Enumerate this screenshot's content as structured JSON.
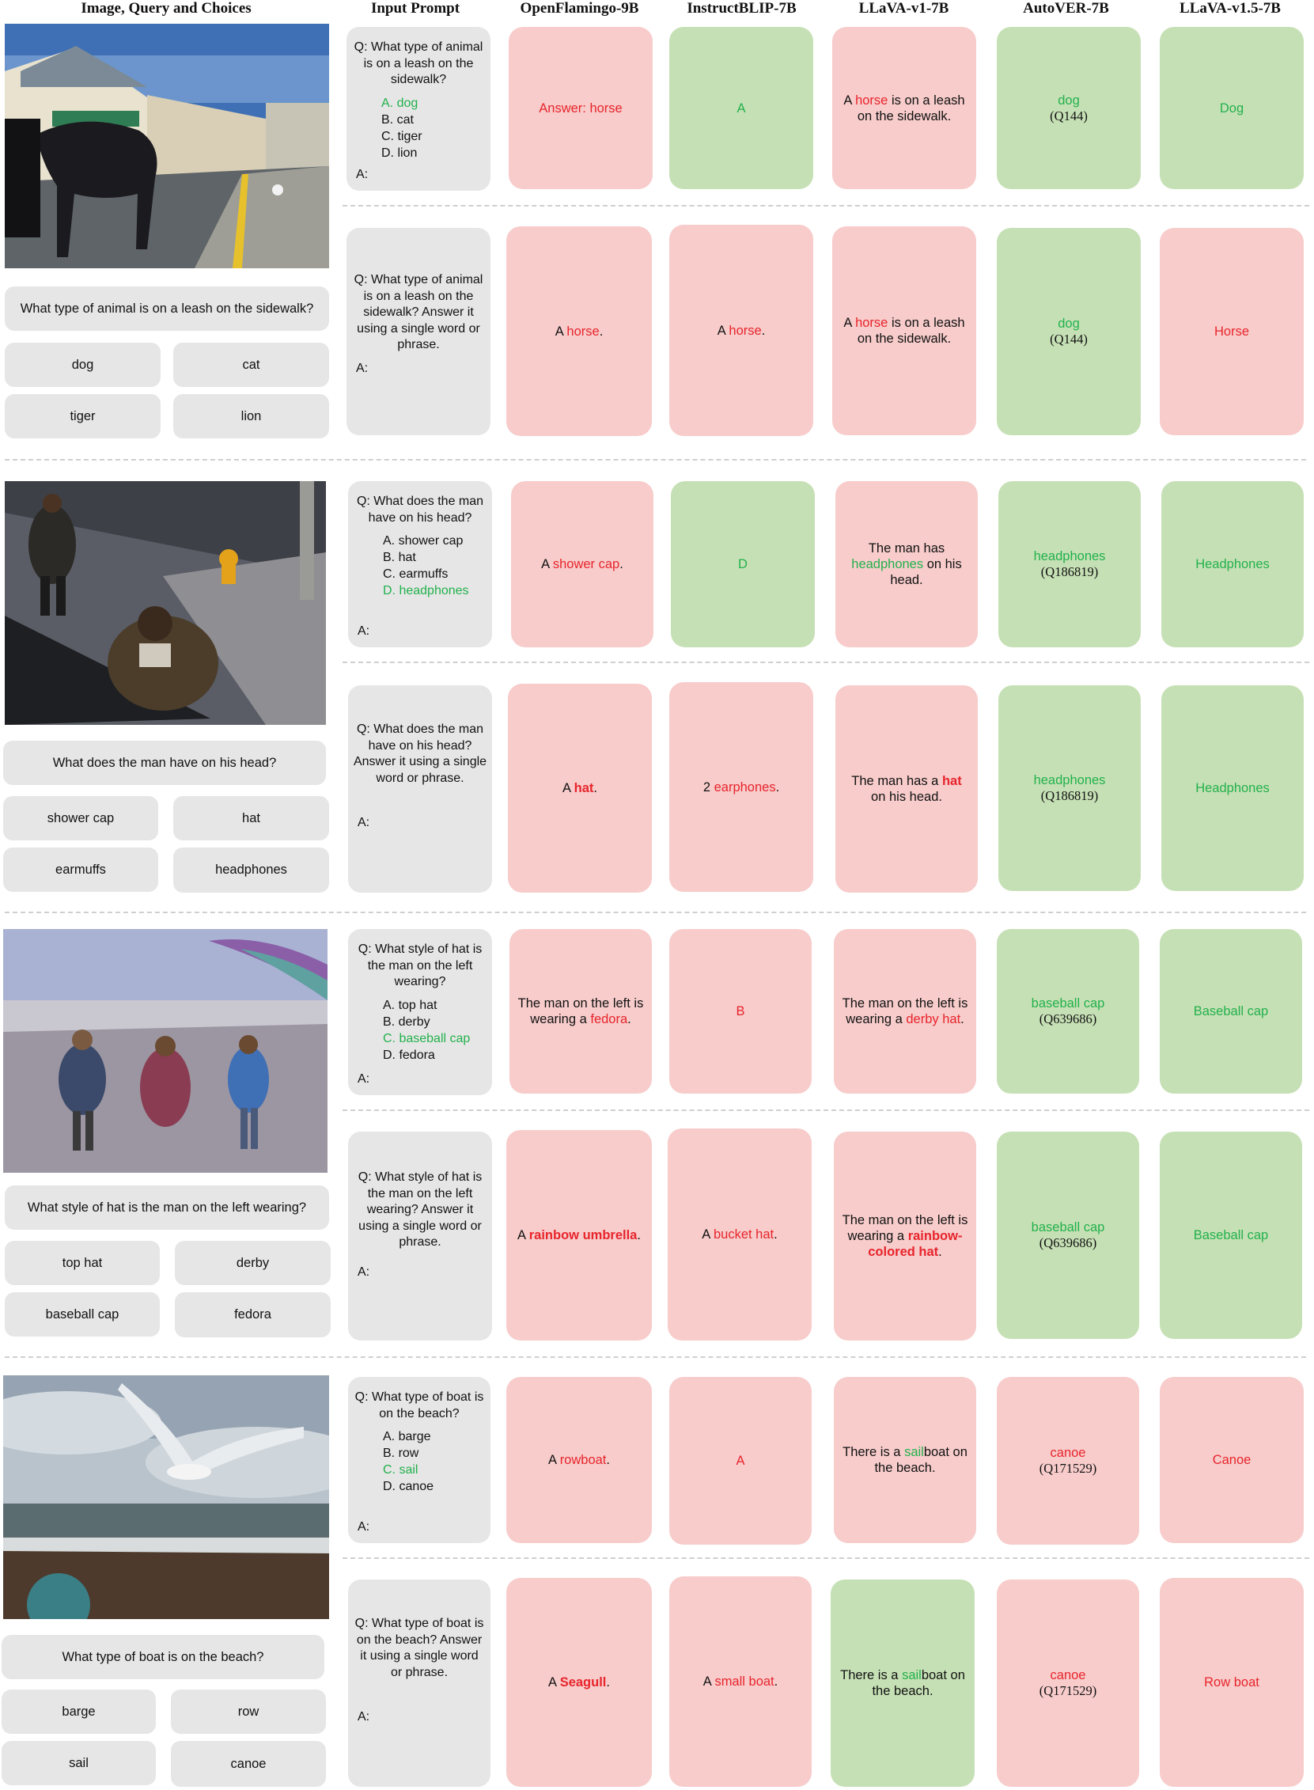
{
  "headers": [
    "Image, Query and Choices",
    "Input Prompt",
    "OpenFlamingo-9B",
    "InstructBLIP-7B",
    "LLaVA-v1-7B",
    "AutoVER-7B",
    "LLaVA-v1.5-7B"
  ],
  "examples": [
    {
      "query": "What type of animal is on a leash on the sidewalk?",
      "choices": [
        "dog",
        "cat",
        "tiger",
        "lion"
      ],
      "mc_prompt": {
        "question": "Q: What type of animal is on a leash on the sidewalk?",
        "options": [
          "A.  dog",
          "B.  cat",
          "C.  tiger",
          "D.  lion"
        ],
        "correct": 0,
        "answer_label": "A:"
      },
      "oe_prompt": {
        "question": "Q: What type of animal is on a leash on the sidewalk? Answer it using a single word or phrase.",
        "answer_label": "A:"
      },
      "mc_answers": {
        "openflamingo": {
          "pre": "",
          "hl": "Answer: horse",
          "post": ""
        },
        "instructblip": {
          "pre": "",
          "hl": "A",
          "post": ""
        },
        "llava_v1": {
          "pre": "A ",
          "hl": "horse",
          "post": " is on a leash on the sidewalk."
        },
        "autover": {
          "entity": "dog",
          "qid": "(Q144)"
        },
        "llava_v15": {
          "pre": "",
          "hl": "Dog",
          "post": ""
        }
      },
      "oe_answers": {
        "openflamingo": {
          "pre": "A ",
          "hl": "horse",
          "post": "."
        },
        "instructblip": {
          "pre": "A ",
          "hl": "horse",
          "post": "."
        },
        "llava_v1": {
          "pre": "A ",
          "hl": "horse",
          "post": " is on a leash on the sidewalk."
        },
        "autover": {
          "entity": "dog",
          "qid": "(Q144)"
        },
        "llava_v15": {
          "pre": "",
          "hl": "Horse",
          "post": ""
        }
      }
    },
    {
      "query": "What does the man have on his head?",
      "choices": [
        "shower cap",
        "hat",
        "earmuffs",
        "headphones"
      ],
      "mc_prompt": {
        "question": "Q: What does the man have on his head?",
        "options": [
          "A.  shower cap",
          "B.  hat",
          "C.  earmuffs",
          "D.  headphones"
        ],
        "correct": 3,
        "answer_label": "A:"
      },
      "oe_prompt": {
        "question": "Q: What does the man have on his head? Answer it using a single word or phrase.",
        "answer_label": "A:"
      },
      "mc_answers": {
        "openflamingo": {
          "pre": "A ",
          "hl": "shower cap",
          "post": "."
        },
        "instructblip": {
          "pre": "",
          "hl": "D",
          "post": ""
        },
        "llava_v1": {
          "pre": "The man has ",
          "hl": "headphones",
          "post": " on his head."
        },
        "autover": {
          "entity": "headphones",
          "qid": "(Q186819)"
        },
        "llava_v15": {
          "pre": "",
          "hl": "Headphones",
          "post": ""
        }
      },
      "oe_answers": {
        "openflamingo": {
          "pre": "A ",
          "hl": "hat",
          "post": "."
        },
        "instructblip": {
          "pre": "2 ",
          "hl": "earphones",
          "post": "."
        },
        "llava_v1": {
          "pre": "The man has a ",
          "hl": "hat",
          "post": " on his head."
        },
        "autover": {
          "entity": "headphones",
          "qid": "(Q186819)"
        },
        "llava_v15": {
          "pre": "",
          "hl": "Headphones",
          "post": ""
        }
      }
    },
    {
      "query": "What style of hat is the man on the left wearing?",
      "choices": [
        "top hat",
        "derby",
        "baseball cap",
        "fedora"
      ],
      "mc_prompt": {
        "question": "Q: What style of hat is the man on the left wearing?",
        "options": [
          "A.  top hat",
          "B.  derby",
          "C.  baseball cap",
          "D.  fedora"
        ],
        "correct": 2,
        "answer_label": "A:"
      },
      "oe_prompt": {
        "question": "Q: What style of hat is the man on the left wearing? Answer it using a single word or phrase.",
        "answer_label": "A:"
      },
      "mc_answers": {
        "openflamingo": {
          "pre": "The man on the left is wearing a ",
          "hl": "fedora",
          "post": "."
        },
        "instructblip": {
          "pre": "",
          "hl": "B",
          "post": ""
        },
        "llava_v1": {
          "pre": "The man on the left is wearing a ",
          "hl": "derby hat",
          "post": "."
        },
        "autover": {
          "entity": "baseball cap",
          "qid": "(Q639686)"
        },
        "llava_v15": {
          "pre": "",
          "hl": "Baseball cap",
          "post": ""
        }
      },
      "oe_answers": {
        "openflamingo": {
          "pre": "A ",
          "hl": "rainbow umbrella",
          "post": "."
        },
        "instructblip": {
          "pre": "A ",
          "hl": "bucket hat",
          "post": "."
        },
        "llava_v1": {
          "pre": "The man on the left is wearing a ",
          "hl": "rainbow-colored hat",
          "post": "."
        },
        "autover": {
          "entity": "baseball cap",
          "qid": "(Q639686)"
        },
        "llava_v15": {
          "pre": "",
          "hl": "Baseball cap",
          "post": ""
        }
      }
    },
    {
      "query": "What type of boat is on the beach?",
      "choices": [
        "barge",
        "row",
        "sail",
        "canoe"
      ],
      "mc_prompt": {
        "question": "Q: What type of boat is on the beach?",
        "options": [
          "A.  barge",
          "B.  row",
          "C.  sail",
          "D.  canoe"
        ],
        "correct": 2,
        "answer_label": "A:"
      },
      "oe_prompt": {
        "question": "Q: What type of boat is on the beach? Answer it using a single word or phrase.",
        "answer_label": "A:"
      },
      "mc_answers": {
        "openflamingo": {
          "pre": "A ",
          "hl": "rowboat",
          "post": "."
        },
        "instructblip": {
          "pre": "",
          "hl": "A",
          "post": ""
        },
        "llava_v1": {
          "pre": "There is a ",
          "hl": "sail",
          "post": "boat on the beach."
        },
        "autover": {
          "entity": "canoe",
          "qid": "(Q171529)"
        },
        "llava_v15": {
          "pre": "",
          "hl": "Canoe",
          "post": ""
        }
      },
      "oe_answers": {
        "openflamingo": {
          "pre": "A ",
          "hl": "Seagull",
          "post": "."
        },
        "instructblip": {
          "pre": "A ",
          "hl": "small boat",
          "post": "."
        },
        "llava_v1": {
          "pre": "There is a ",
          "hl": "sail",
          "post": "boat on the beach."
        },
        "autover": {
          "entity": "canoe",
          "qid": "(Q171529)"
        },
        "llava_v15": {
          "pre": "",
          "hl": "Row boat",
          "post": ""
        }
      }
    }
  ],
  "colors": {
    "wrong_bg": "#f7cccb",
    "correct_bg": "#c6e0b5",
    "wrong_text": "#e8242b",
    "correct_text": "#22b14c",
    "box_bg": "#e6e6e6"
  }
}
